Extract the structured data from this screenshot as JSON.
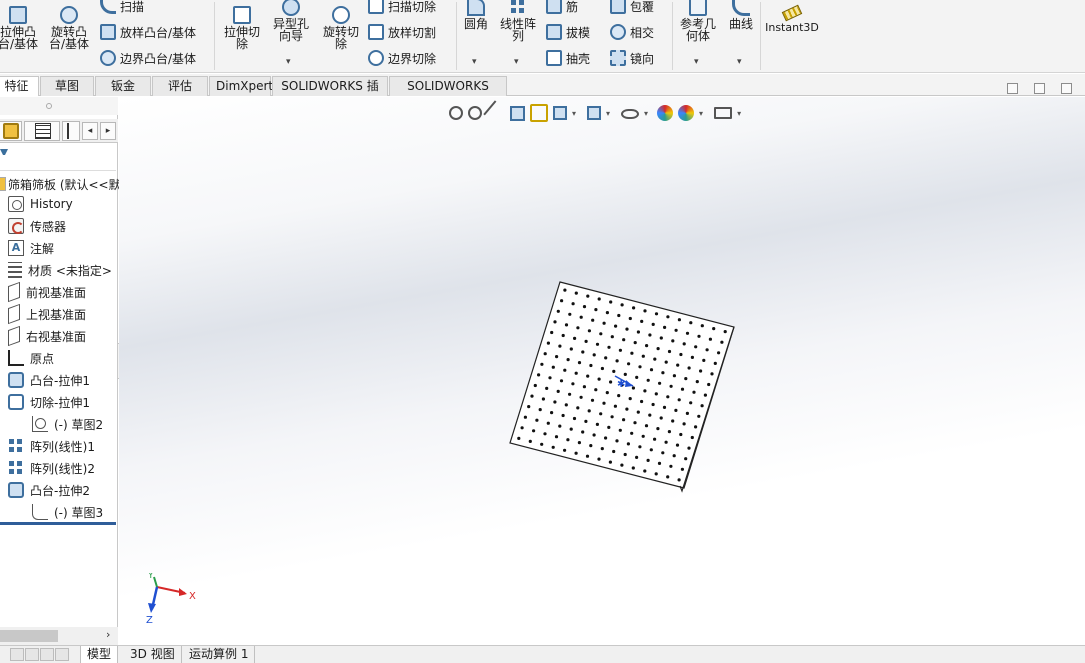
{
  "ribbon": {
    "extrude_boss": "拉伸凸\n台/基体",
    "revolve_boss": "旋转凸\n台/基体",
    "sweep": "扫描",
    "loft_boss": "放样凸台/基体",
    "boundary_boss": "边界凸台/基体",
    "extrude_cut": "拉伸切\n除",
    "hole_wizard": "异型孔\n向导",
    "revolve_cut": "旋转切\n除",
    "swept_cut": "扫描切除",
    "lofted_cut": "放样切割",
    "boundary_cut": "边界切除",
    "fillet": "圆角",
    "linear_pattern": "线性阵\n列",
    "rib": "筋",
    "draft": "拔模",
    "shell": "抽壳",
    "wrap": "包覆",
    "intersect": "相交",
    "mirror": "镜向",
    "ref_geometry": "参考几\n何体",
    "curves": "曲线",
    "instant3d": "Instant3D"
  },
  "tabs": [
    "特征",
    "草图",
    "钣金",
    "评估",
    "DimXpert",
    "SOLIDWORKS 插件",
    "SOLIDWORKS MBD"
  ],
  "tree": {
    "root": "筛箱筛板 (默认<<默",
    "items": [
      {
        "label": "History",
        "icon": "history-icon"
      },
      {
        "label": "传感器",
        "icon": "sensor-icon"
      },
      {
        "label": "注解",
        "icon": "annotation-icon"
      },
      {
        "label": "材质 <未指定>",
        "icon": "material-icon"
      },
      {
        "label": "前视基准面",
        "icon": "plane-icon"
      },
      {
        "label": "上视基准面",
        "icon": "plane-icon"
      },
      {
        "label": "右视基准面",
        "icon": "plane-icon"
      },
      {
        "label": "原点",
        "icon": "origin-icon"
      },
      {
        "label": "凸台-拉伸1",
        "icon": "boss-extrude-icon"
      },
      {
        "label": "切除-拉伸1",
        "icon": "cut-extrude-icon"
      },
      {
        "label": "(-) 草图2",
        "icon": "sketch-icon"
      },
      {
        "label": "阵列(线性)1",
        "icon": "linear-pattern-icon"
      },
      {
        "label": "阵列(线性)2",
        "icon": "linear-pattern-icon"
      },
      {
        "label": "凸台-拉伸2",
        "icon": "boss-extrude-icon"
      },
      {
        "label": "(-) 草图3",
        "icon": "sketch-icon"
      }
    ]
  },
  "triad": {
    "x": "X",
    "y": "Y",
    "z": "Z"
  },
  "bottom_tabs": [
    "模型",
    "3D 视图",
    "运动算例 1"
  ],
  "colors": {
    "accent": "#3e6f9e",
    "rollback_bar": "#2f5d99",
    "triad_x": "#d62828",
    "triad_y": "#2a9d4a",
    "triad_z": "#1f4fd1"
  }
}
